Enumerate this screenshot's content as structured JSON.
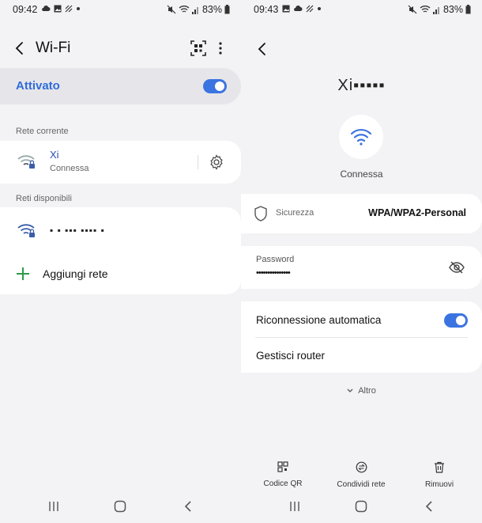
{
  "left": {
    "status": {
      "time": "09:42",
      "battery": "83%"
    },
    "title": "Wi-Fi",
    "activated_label": "Attivato",
    "current_section": "Rete corrente",
    "current_network": {
      "ssid": "Xi",
      "status": "Connessa"
    },
    "available_section": "Reti disponibili",
    "available_network": {
      "ssid": "▪ ▪ ▪▪▪ ▪▪▪▪ ▪"
    },
    "add_network": "Aggiungi rete"
  },
  "right": {
    "status": {
      "time": "09:43",
      "battery": "83%"
    },
    "ssid": "Xi▪▪▪▪▪",
    "connection_status": "Connessa",
    "security": {
      "label": "Sicurezza",
      "value": "WPA/WPA2-Personal"
    },
    "password": {
      "label": "Password",
      "value": "•••••••••••••••"
    },
    "auto_reconnect": "Riconnessione automatica",
    "manage_router": "Gestisci router",
    "more": "Altro",
    "actions": {
      "qr": "Codice QR",
      "share": "Condividi rete",
      "remove": "Rimuovi"
    }
  },
  "colors": {
    "accent": "#3b74e0",
    "activated_text": "#2f6bd9",
    "background": "#f3f3f5"
  }
}
